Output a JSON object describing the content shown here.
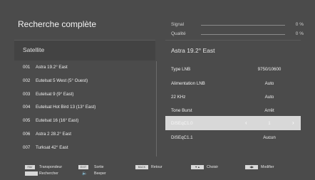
{
  "header": {
    "title": "Recherche complète",
    "signal_label": "Signal",
    "signal_value": "0 %",
    "signal_level": 0,
    "quality_label": "Qualité",
    "quality_value": "0 %",
    "quality_level": 0
  },
  "left_panel": {
    "heading": "Satellite",
    "items": [
      {
        "num": "001",
        "name": "Astra 19.2° East"
      },
      {
        "num": "002",
        "name": "Eutelsat 5 West (5° Ouest)"
      },
      {
        "num": "003",
        "name": "Eutelsat 9 (9° East)"
      },
      {
        "num": "004",
        "name": "Eutelsat Hot Bird 13 (13° East)"
      },
      {
        "num": "005",
        "name": "Eutelsat 16 (16° East)"
      },
      {
        "num": "006",
        "name": "Astra 2 28.2° East"
      },
      {
        "num": "007",
        "name": "Turksat 42° East"
      }
    ]
  },
  "right_panel": {
    "heading": "Astra 19.2° East",
    "params": [
      {
        "label": "Type LNB",
        "value": "9750/10600"
      },
      {
        "label": "Alimentation LNB",
        "value": "Auto"
      },
      {
        "label": "22 KHz",
        "value": "Auto"
      },
      {
        "label": "Tone Burst",
        "value": "Arrêt"
      },
      {
        "label": "DiSEqC1.0",
        "value": "1"
      },
      {
        "label": "DiSEqC1.1",
        "value": "Aucun"
      }
    ],
    "selected_index": 4,
    "arrow_left": "‹",
    "arrow_right": "›"
  },
  "footer": {
    "transponder_key": "FAV",
    "transponder_label": "Transpondeur",
    "exit_key": "EXIT",
    "exit_label": "Sortie",
    "back_key": "BACK",
    "back_label": "Retour",
    "choose_label": "Choisir",
    "modify_label": "Modifier",
    "search_label": "Rechercher",
    "beeper_label": "Beeper"
  },
  "colors": {
    "background": "#4b4b4b",
    "highlight": "#d8d8d8"
  }
}
